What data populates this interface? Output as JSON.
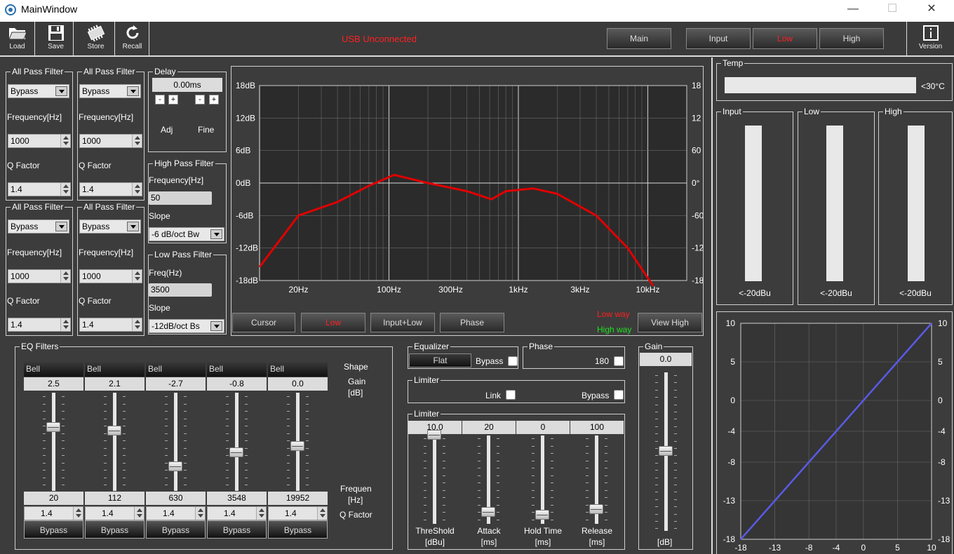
{
  "window": {
    "title": "MainWindow",
    "minimize": "—",
    "maximize": "☐",
    "close": "✕"
  },
  "toolbar": {
    "load": "Load",
    "save": "Save",
    "store": "Store",
    "recall": "Recall",
    "version": "Version",
    "status": "USB Unconnected"
  },
  "nav": {
    "main": "Main",
    "input": "Input",
    "low": "Low",
    "high": "High"
  },
  "apf": [
    {
      "title": "All Pass Filter",
      "mode": "Bypass",
      "freq_label": "Frequency[Hz]",
      "freq": "1000",
      "q_label": "Q Factor",
      "q": "1.4"
    },
    {
      "title": "All Pass Filter",
      "mode": "Bypass",
      "freq_label": "Frequency[Hz]",
      "freq": "1000",
      "q_label": "Q Factor",
      "q": "1.4"
    },
    {
      "title": "All Pass Filter",
      "mode": "Bypass",
      "freq_label": "Frequency[Hz]",
      "freq": "1000",
      "q_label": "Q Factor",
      "q": "1.4"
    },
    {
      "title": "All Pass Filter",
      "mode": "Bypass",
      "freq_label": "Frequency[Hz]",
      "freq": "1000",
      "q_label": "Q Factor",
      "q": "1.4"
    }
  ],
  "delay": {
    "title": "Delay",
    "value": "0.00ms",
    "minus": "-",
    "plus": "+",
    "adj": "Adj",
    "fine": "Fine"
  },
  "hpf": {
    "title": "High Pass Filter",
    "freq_label": "Frequency[Hz]",
    "freq": "50",
    "slope_label": "Slope",
    "slope": "-6 dB/oct Bw"
  },
  "lpf": {
    "title": "Low Pass Filter",
    "freq_label": "Freq(Hz)",
    "freq": "3500",
    "slope_label": "Slope",
    "slope": "-12dB/oct Bs"
  },
  "graph": {
    "left_ticks": [
      "18dB",
      "12dB",
      "6dB",
      "0dB",
      "-6dB",
      "-12dB",
      "-18dB"
    ],
    "right_ticks": [
      "18",
      "12",
      "60",
      "0°",
      "-60",
      "-12",
      "-18"
    ],
    "x_ticks": [
      "20Hz",
      "100Hz",
      "300Hz",
      "1kHz",
      "3kHz",
      "10kHz"
    ],
    "curve_color": "#e00000"
  },
  "graph_buttons": {
    "cursor": "Cursor",
    "low": "Low",
    "input_low": "Input+Low",
    "phase": "Phase",
    "view_high": "View High",
    "low_way": "Low way",
    "high_way": "High way"
  },
  "eq": {
    "title": "EQ Filters",
    "shape_label": "Shape",
    "gain_label": "Gain",
    "gain_unit": "[dB]",
    "freq_label": "Frequen",
    "freq_unit": "[Hz]",
    "q_label": "Q Factor",
    "bands": [
      {
        "shape": "Bell",
        "gain": "2.5",
        "gain_level": 2.5,
        "freq": "20",
        "q": "1.4",
        "bypass": "Bypass"
      },
      {
        "shape": "Bell",
        "gain": "2.1",
        "gain_level": 2.1,
        "freq": "112",
        "q": "1.4",
        "bypass": "Bypass"
      },
      {
        "shape": "Bell",
        "gain": "-2.7",
        "gain_level": -2.7,
        "freq": "630",
        "q": "1.4",
        "bypass": "Bypass"
      },
      {
        "shape": "Bell",
        "gain": "-0.8",
        "gain_level": -0.8,
        "freq": "3548",
        "q": "1.4",
        "bypass": "Bypass"
      },
      {
        "shape": "Bell",
        "gain": "0.0",
        "gain_level": 0.0,
        "freq": "19952",
        "q": "1.4",
        "bypass": "Bypass"
      }
    ]
  },
  "equalizer": {
    "title": "Equalizer",
    "flat": "Flat",
    "bypass": "Bypass"
  },
  "phase": {
    "title": "Phase",
    "value": "180"
  },
  "limiter_link": {
    "title": "Limiter",
    "link": "Link",
    "bypass": "Bypass"
  },
  "limiter": {
    "title": "Limiter",
    "params": [
      {
        "value": "10.0",
        "label": "ThreShold",
        "unit": "[dBu]"
      },
      {
        "value": "20",
        "label": "Attack",
        "unit": "[ms]"
      },
      {
        "value": "0",
        "label": "Hold Time",
        "unit": "[ms]"
      },
      {
        "value": "100",
        "label": "Release",
        "unit": "[ms]"
      }
    ]
  },
  "gain": {
    "title": "Gain",
    "value": "0.0",
    "unit": "[dB]"
  },
  "temp": {
    "title": "Temp",
    "value": "<30°C"
  },
  "meters": [
    {
      "title": "Input",
      "value": "<-20dBu"
    },
    {
      "title": "Low",
      "value": "<-20dBu"
    },
    {
      "title": "High",
      "value": "<-20dBu"
    }
  ],
  "transfer": {
    "y_left": [
      "10",
      "5",
      "0",
      "-4",
      "-8",
      "-13",
      "-18"
    ],
    "y_right": [
      "10",
      "5",
      "0",
      "-4",
      "-8",
      "-13",
      "-18"
    ],
    "x_ticks": [
      "-18",
      "-13",
      "-8",
      "-4",
      "0",
      "5",
      "10"
    ],
    "line_color": "#5a5ae8"
  }
}
